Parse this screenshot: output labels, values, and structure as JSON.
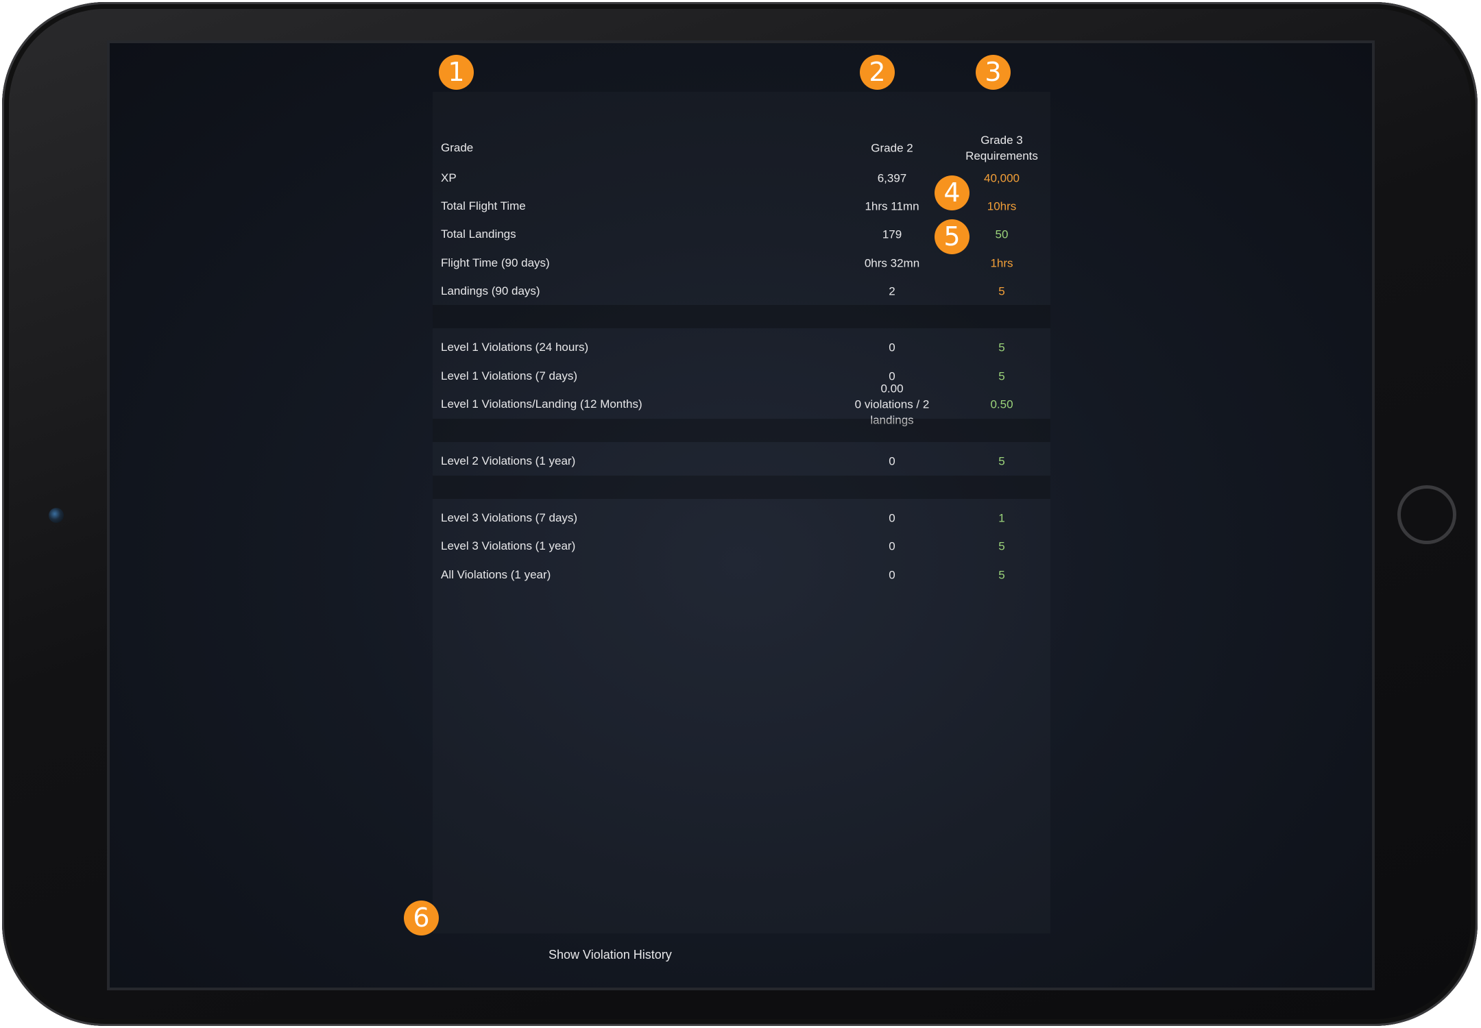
{
  "headers": {
    "label": "Grade",
    "current": "Grade 2",
    "requirements_line1": "Grade 3",
    "requirements_line2": "Requirements"
  },
  "rows": [
    {
      "label": "XP",
      "current": "6,397",
      "requirement": "40,000",
      "status": "orange"
    },
    {
      "label": "Total Flight Time",
      "current": "1hrs 11mn",
      "requirement": "10hrs",
      "status": "orange"
    },
    {
      "label": "Total Landings",
      "current": "179",
      "requirement": "50",
      "status": "green"
    },
    {
      "label": "Flight Time (90 days)",
      "current": "0hrs 32mn",
      "requirement": "1hrs",
      "status": "orange"
    },
    {
      "label": "Landings (90 days)",
      "current": "2",
      "requirement": "5",
      "status": "orange"
    },
    {
      "label": "Level 1 Violations (24 hours)",
      "current": "0",
      "requirement": "5",
      "status": "green"
    },
    {
      "label": "Level 1 Violations (7 days)",
      "current": "0",
      "requirement": "5",
      "status": "green"
    },
    {
      "label": "Level 1 Violations/Landing (12 Months)",
      "current": "0.00",
      "current_sub": "0 violations / 2 landings",
      "requirement": "0.50",
      "status": "green"
    },
    {
      "label": "Level 2 Violations (1 year)",
      "current": "0",
      "requirement": "5",
      "status": "green"
    },
    {
      "label": "Level 3 Violations (7 days)",
      "current": "0",
      "requirement": "1",
      "status": "green"
    },
    {
      "label": "Level 3 Violations (1 year)",
      "current": "0",
      "requirement": "5",
      "status": "green"
    },
    {
      "label": "All Violations (1 year)",
      "current": "0",
      "requirement": "5",
      "status": "green"
    }
  ],
  "badges": [
    "1",
    "2",
    "3",
    "4",
    "5",
    "6"
  ],
  "history_link": "Show Violation History",
  "colors": {
    "badge": "#f7931e",
    "orange": "#f29f38",
    "green": "#9bd37a"
  }
}
